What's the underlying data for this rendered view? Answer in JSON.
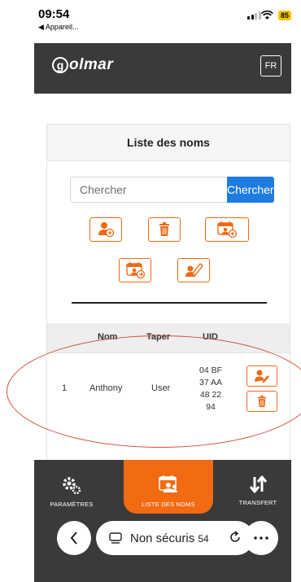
{
  "status_bar": {
    "time": "09:54",
    "back_label": "◀ Appareil...",
    "battery": "85"
  },
  "header": {
    "logo": "golmar",
    "language": "FR"
  },
  "card": {
    "title": "Liste des noms",
    "search_placeholder": "Chercher",
    "search_button": "Chercher"
  },
  "toolbar": {
    "buttons": [
      "add-user-icon",
      "trash-icon",
      "calendar-add-icon",
      "calendar-user-icon",
      "edit-card-icon"
    ]
  },
  "table": {
    "columns": [
      "Nom",
      "Taper",
      "UID"
    ],
    "rows": [
      {
        "index": "1",
        "name": "Anthony",
        "type": "User",
        "uid": [
          "04 BF",
          "37 AA",
          "48 22",
          "94"
        ]
      }
    ]
  },
  "bottom_nav": {
    "items": [
      {
        "label": "PARAMÈTRES",
        "icon": "gear-icon"
      },
      {
        "label": "LISTE DES NOMS",
        "icon": "calendar-users-icon",
        "active": true
      },
      {
        "label": "TRANSFERT",
        "icon": "transfer-arrows-icon"
      }
    ]
  },
  "browser": {
    "url_text": "Non sécuris",
    "url_suffix": "54"
  },
  "colors": {
    "accent": "#f26a12",
    "primary_button": "#1e7ce0",
    "dark_bar": "#3a3a3b",
    "annotation": "#d64a3a"
  }
}
